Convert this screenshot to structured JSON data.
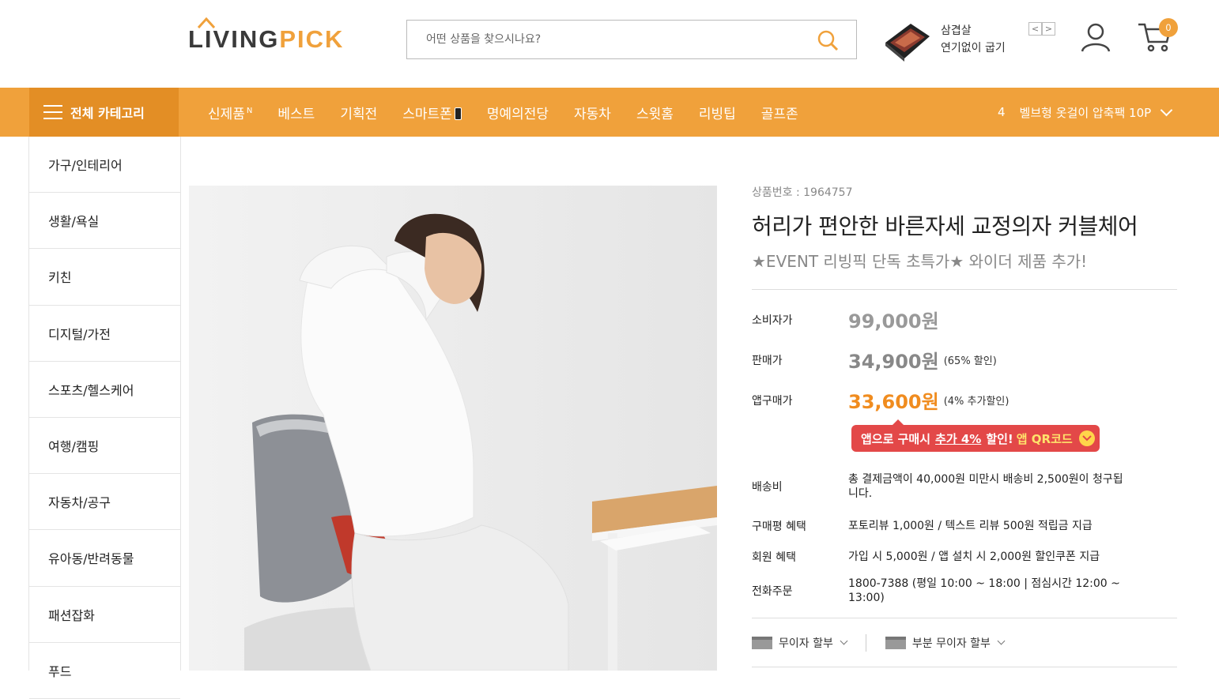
{
  "brand": {
    "logo_part1": "LIVING",
    "logo_part2": "PICK"
  },
  "search": {
    "placeholder": "어떤 상품을 찾으시나요?"
  },
  "promo": {
    "line1": "삼겹살",
    "line2": "연기없이 굽기",
    "prev": "<",
    "next": ">"
  },
  "cart": {
    "count": "0"
  },
  "nav": {
    "all_categories": "전체 카테고리",
    "items": [
      {
        "label": "신제품",
        "badge": "N"
      },
      {
        "label": "베스트"
      },
      {
        "label": "기획전"
      },
      {
        "label": "스마트폰"
      },
      {
        "label": "명예의전당"
      },
      {
        "label": "자동차"
      },
      {
        "label": "스윗홈"
      },
      {
        "label": "리빙팁"
      },
      {
        "label": "골프존"
      }
    ],
    "ticker": {
      "rank": "4",
      "text": "벨브형 옷걸이 압축팩 10P"
    }
  },
  "sidebar": {
    "items": [
      {
        "label": "가구/인테리어"
      },
      {
        "label": "생활/욕실"
      },
      {
        "label": "키친"
      },
      {
        "label": "디지털/가전"
      },
      {
        "label": "스포츠/헬스케어"
      },
      {
        "label": "여행/캠핑"
      },
      {
        "label": "자동차/공구"
      },
      {
        "label": "유아동/반려동물"
      },
      {
        "label": "패션잡화"
      },
      {
        "label": "푸드"
      }
    ]
  },
  "product": {
    "number": "상품번호 : 1964757",
    "title": "허리가 편안한 바른자세 교정의자 커블체어",
    "subtitle": "★EVENT 리빙픽 단독 초특가★ 와이더 제품 추가!",
    "prices": {
      "consumer_label": "소비자가",
      "consumer_price": "99,000원",
      "sale_label": "판매가",
      "sale_price": "34,900원",
      "sale_note": "(65% 할인)",
      "app_label": "앱구매가",
      "app_price": "33,600원",
      "app_note": "(4% 추가할인)"
    },
    "app_banner": {
      "prefix": "앱으로 구매시",
      "strong": "추가 4%",
      "suffix": "할인!",
      "qr": "앱 QR코드"
    },
    "details": [
      {
        "label": "배송비",
        "value": "총 결제금액이 40,000원 미만시 배송비 2,500원이 청구됩니다."
      },
      {
        "label": "구매평 혜택",
        "value": "포토리뷰 1,000원 / 텍스트 리뷰 500원 적립금 지급"
      },
      {
        "label": "회원 혜택",
        "value": "가입 시 5,000원 / 앱 설치 시 2,000원 할인쿠폰 지급"
      },
      {
        "label": "전화주문",
        "value": "1800-7388 (평일 10:00 ~ 18:00 | 점심시간 12:00 ~ 13:00)"
      }
    ],
    "installments": {
      "interest_free": "무이자 할부",
      "partial_interest_free": "부분 무이자 할부"
    }
  },
  "colors": {
    "accent": "#f0a13b",
    "accent_dark": "#e38e25",
    "app_price": "#f08c1f",
    "banner": "#e34848"
  }
}
